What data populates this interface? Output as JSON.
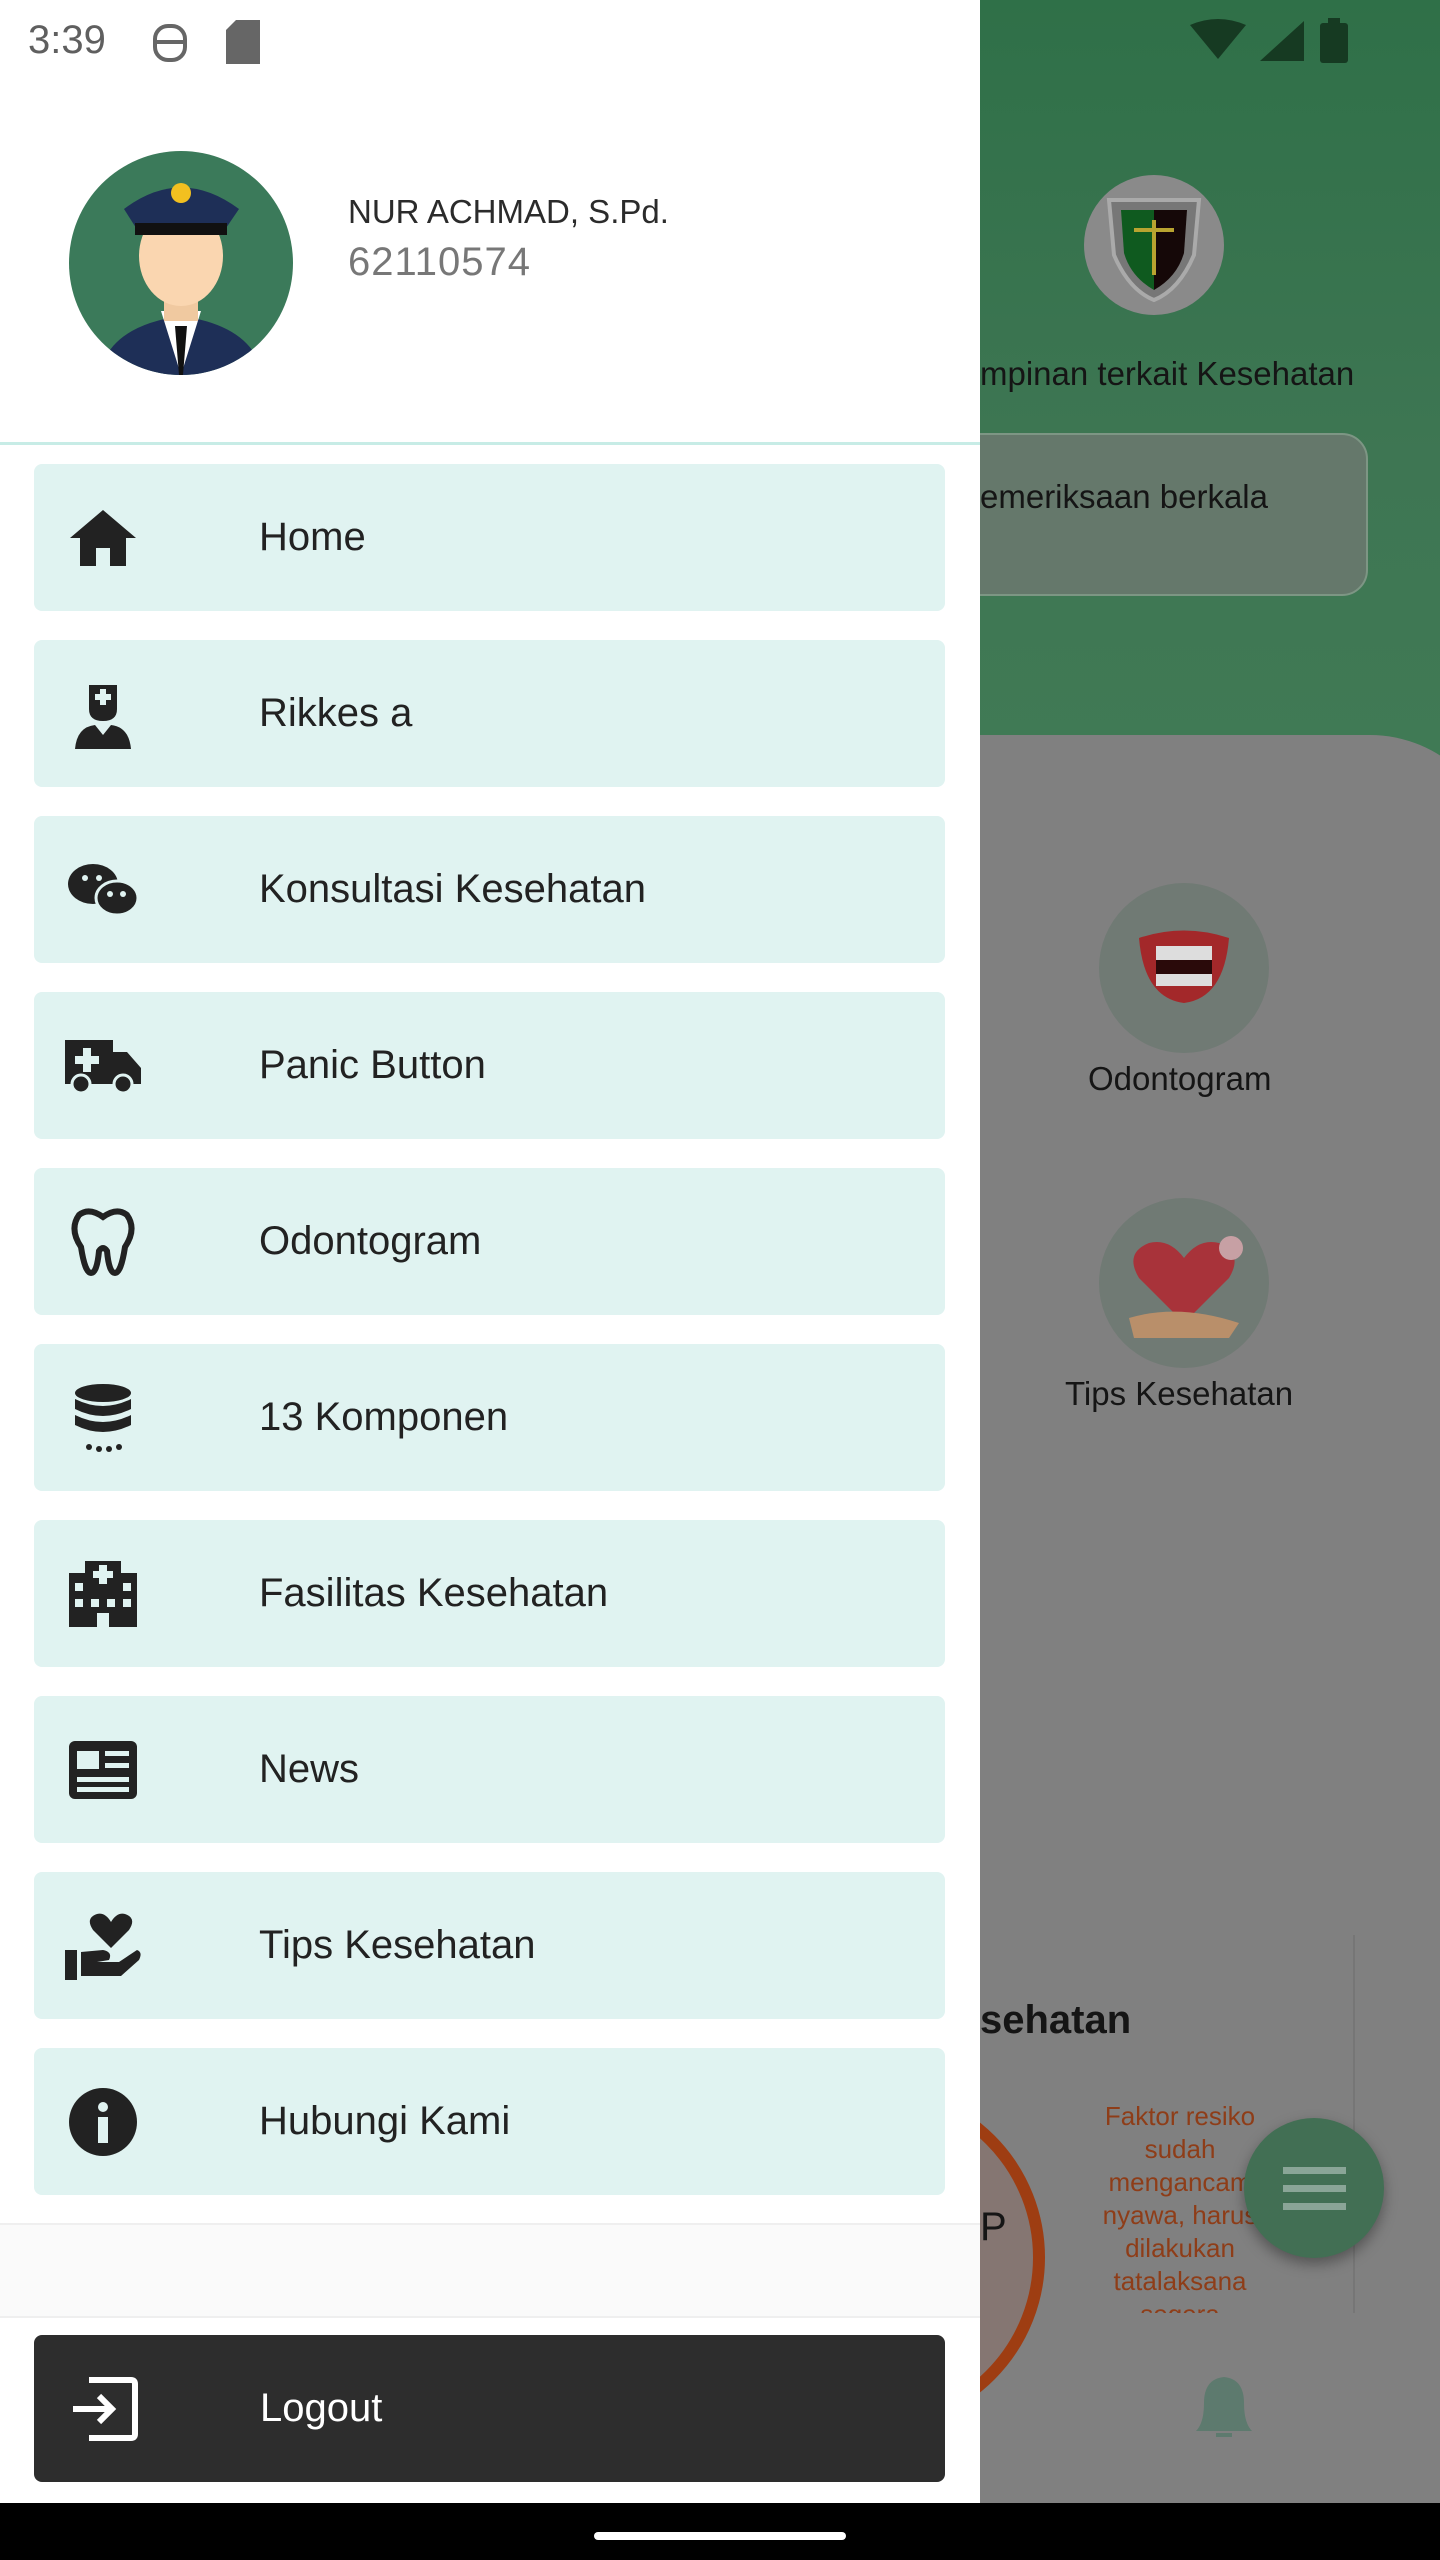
{
  "status_bar": {
    "time": "3:39"
  },
  "profile": {
    "name": "NUR ACHMAD, S.Pd.",
    "nrp": "62110574"
  },
  "menu": [
    {
      "label": "Home",
      "icon": "home-icon"
    },
    {
      "label": "Rikkes a",
      "icon": "medic-icon"
    },
    {
      "label": "Konsultasi Kesehatan",
      "icon": "chat-icon"
    },
    {
      "label": "Panic Button",
      "icon": "ambulance-icon"
    },
    {
      "label": "Odontogram",
      "icon": "tooth-icon"
    },
    {
      "label": "13 Komponen",
      "icon": "database-icon"
    },
    {
      "label": "Fasilitas Kesehatan",
      "icon": "hospital-icon"
    },
    {
      "label": "News",
      "icon": "newspaper-icon"
    },
    {
      "label": "Tips Kesehatan",
      "icon": "hand-heart-icon"
    },
    {
      "label": "Hubungi Kami",
      "icon": "info-icon"
    }
  ],
  "logout": {
    "label": "Logout",
    "icon": "logout-icon"
  },
  "background": {
    "subtitle": "mpinan terkait Kesehatan",
    "box_text": "emeriksaan berkala",
    "odontogram": "Odontogram",
    "tips": "Tips Kesehatan",
    "section_title": "sehatan",
    "ring_text": "P",
    "faktor": "Faktor resiko sudah mengancam nyawa, harus dilakukan tatalaksana segera"
  },
  "colors": {
    "menu_bg": "#e0f3f1",
    "logout_bg": "#2d2d2d",
    "brand_green": "#3e7653"
  }
}
